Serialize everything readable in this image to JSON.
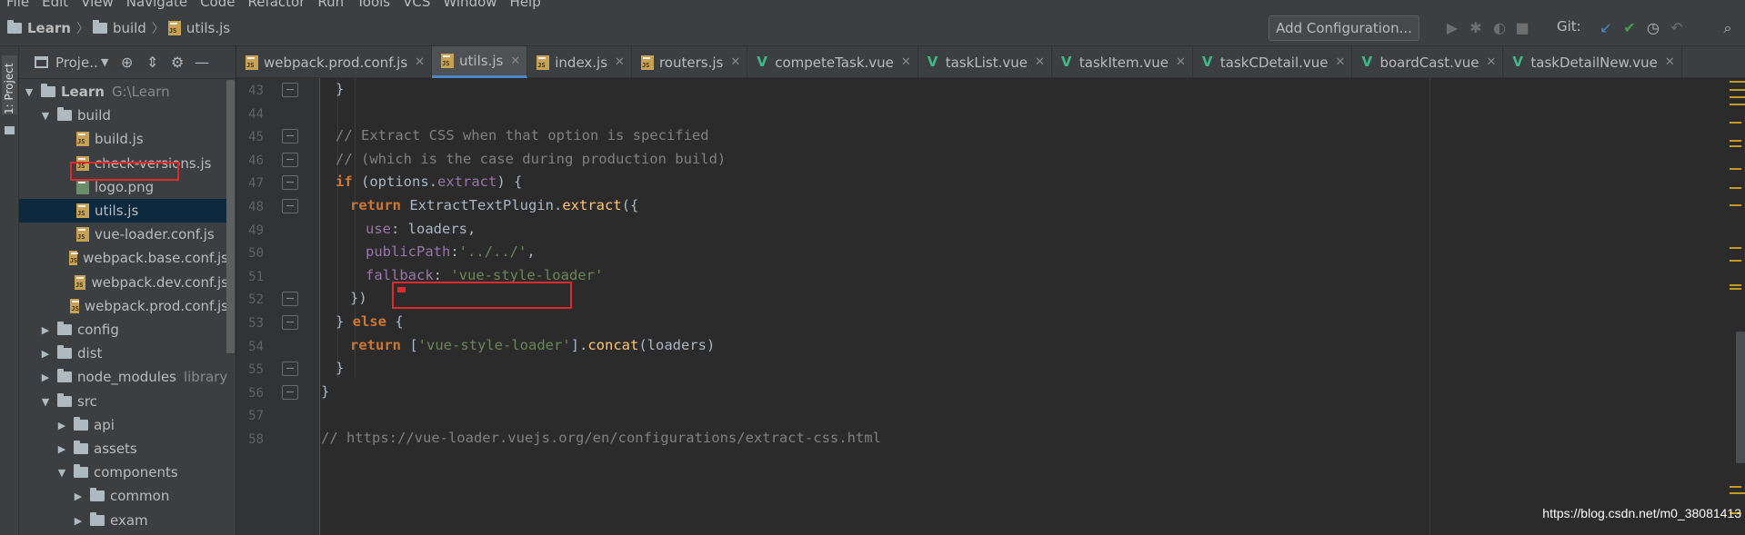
{
  "menu": [
    "File",
    "Edit",
    "View",
    "Navigate",
    "Code",
    "Refactor",
    "Run",
    "Tools",
    "VCS",
    "Window",
    "Help"
  ],
  "breadcrumb": {
    "project": "Learn",
    "folder": "build",
    "file": "utils.js"
  },
  "toolbar": {
    "add_config_label": "Add Configuration...",
    "git_label": "Git:"
  },
  "side_strip": {
    "label": "1: Project"
  },
  "project_panel": {
    "title": "Proje..",
    "tree": [
      {
        "label": "Learn",
        "hint": "G:\\Learn",
        "type": "folder",
        "expanded": true,
        "level": 0
      },
      {
        "label": "build",
        "type": "folder",
        "expanded": true,
        "level": 1
      },
      {
        "label": "build.js",
        "type": "js",
        "level": 2
      },
      {
        "label": "check-versions.js",
        "type": "js",
        "level": 2
      },
      {
        "label": "logo.png",
        "type": "png",
        "level": 2
      },
      {
        "label": "utils.js",
        "type": "js",
        "level": 2,
        "selected": true
      },
      {
        "label": "vue-loader.conf.js",
        "type": "js",
        "level": 2
      },
      {
        "label": "webpack.base.conf.js",
        "type": "js",
        "level": 2
      },
      {
        "label": "webpack.dev.conf.js",
        "type": "js",
        "level": 2
      },
      {
        "label": "webpack.prod.conf.js",
        "type": "js",
        "level": 2
      },
      {
        "label": "config",
        "type": "folder",
        "expanded": false,
        "level": 1
      },
      {
        "label": "dist",
        "type": "folder",
        "expanded": false,
        "level": 1
      },
      {
        "label": "node_modules",
        "hint": "library",
        "type": "folder",
        "expanded": false,
        "level": 1
      },
      {
        "label": "src",
        "type": "folder",
        "expanded": true,
        "level": 1
      },
      {
        "label": "api",
        "type": "folder",
        "expanded": false,
        "level": 2
      },
      {
        "label": "assets",
        "type": "folder",
        "expanded": false,
        "level": 2
      },
      {
        "label": "components",
        "type": "folder",
        "expanded": true,
        "level": 2
      },
      {
        "label": "common",
        "type": "folder",
        "expanded": false,
        "level": 3
      },
      {
        "label": "exam",
        "type": "folder",
        "expanded": false,
        "level": 3
      }
    ]
  },
  "tabs": [
    {
      "label": "webpack.prod.conf.js",
      "type": "js"
    },
    {
      "label": "utils.js",
      "type": "js",
      "active": true
    },
    {
      "label": "index.js",
      "type": "js"
    },
    {
      "label": "routers.js",
      "type": "js"
    },
    {
      "label": "competeTask.vue",
      "type": "vue"
    },
    {
      "label": "taskList.vue",
      "type": "vue"
    },
    {
      "label": "taskItem.vue",
      "type": "vue"
    },
    {
      "label": "taskCDetail.vue",
      "type": "vue"
    },
    {
      "label": "boardCast.vue",
      "type": "vue"
    },
    {
      "label": "taskDetailNew.vue",
      "type": "vue"
    }
  ],
  "code": {
    "line_numbers": [
      "43",
      "44",
      "45",
      "46",
      "47",
      "48",
      "49",
      "50",
      "51",
      "52",
      "53",
      "54",
      "55",
      "56",
      "57",
      "58"
    ],
    "lines": [
      "}",
      "",
      "// Extract CSS when that option is specified",
      "// (which is the case during production build)",
      "if (options.extract) {",
      "return ExtractTextPlugin.extract({",
      "use: loaders,",
      "publicPath:'../../',",
      "fallback: 'vue-style-loader'",
      "})",
      "} else {",
      "return ['vue-style-loader'].concat(loaders)",
      "}",
      "}",
      "",
      "// https://vue-loader.vuejs.org/en/configurations/extract-css.html"
    ]
  },
  "watermark": "https://blog.csdn.net/m0_38081413",
  "colors": {
    "highlight": "#e0292b",
    "background": "#2b2b2b",
    "panel": "#3c3f41"
  }
}
